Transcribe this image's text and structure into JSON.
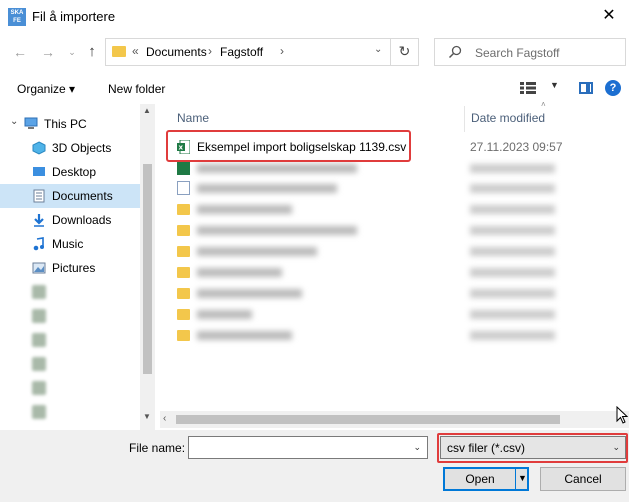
{
  "window": {
    "title": "Fil å importere",
    "app_icon_text": "SKA FE"
  },
  "navbar": {
    "breadcrumb_prefix": "«",
    "breadcrumbs": [
      "Documents",
      "Fagstoff"
    ],
    "search_placeholder": "Search Fagstoff"
  },
  "toolbar": {
    "organize_label": "Organize ▾",
    "new_folder_label": "New folder"
  },
  "navpane": {
    "items": [
      {
        "label": "This PC",
        "icon": "computer-icon",
        "selected": false,
        "blurred": false
      },
      {
        "label": "3D Objects",
        "icon": "cube-icon",
        "selected": false,
        "blurred": false
      },
      {
        "label": "Desktop",
        "icon": "desktop-icon",
        "selected": false,
        "blurred": false
      },
      {
        "label": "Documents",
        "icon": "documents-icon",
        "selected": true,
        "blurred": false
      },
      {
        "label": "Downloads",
        "icon": "download-icon",
        "selected": false,
        "blurred": false
      },
      {
        "label": "Music",
        "icon": "music-icon",
        "selected": false,
        "blurred": false
      },
      {
        "label": "Pictures",
        "icon": "pictures-icon",
        "selected": false,
        "blurred": false
      }
    ]
  },
  "filelist": {
    "columns": {
      "name": "Name",
      "date_modified": "Date modified"
    },
    "files": [
      {
        "name": "Eksempel import boligselskap 1139.csv",
        "date": "27.11.2023 09:57",
        "type": "excel",
        "blurred": false
      }
    ]
  },
  "bottom": {
    "file_name_label": "File name:",
    "file_name_value": "",
    "filter_value": "csv filer (*.csv)",
    "open_label": "Open",
    "cancel_label": "Cancel"
  }
}
